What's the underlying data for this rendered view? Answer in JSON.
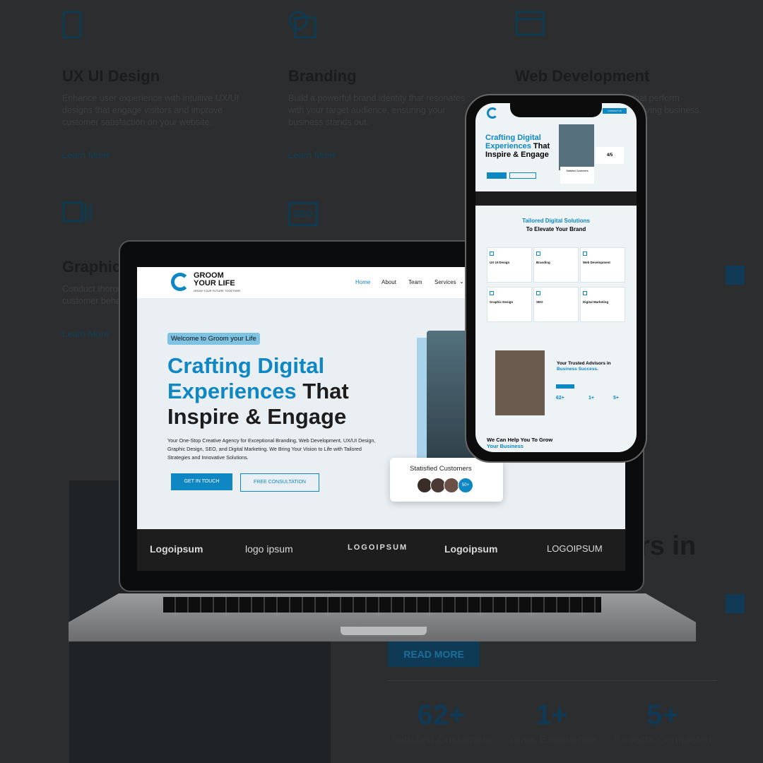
{
  "background": {
    "services": [
      {
        "title": "UX UI Design",
        "desc": "Enhance user experience with intuitive UX/UI designs that engage visitors and improve customer satisfaction on your website.",
        "link": "Learn More"
      },
      {
        "title": "Branding",
        "desc": "Build a powerful brand identity that resonates with your target audience, ensuring your business stands out.",
        "link": "Learn More"
      },
      {
        "title": "Web Development",
        "desc": "Develop responsive websites that perform seamlessly across all devices, driving business."
      },
      {
        "title": "Graphic Design",
        "desc": "Conduct thorough research to provide insights customer behavior.",
        "link": "Learn More"
      }
    ],
    "big_title_fragment": "rs in",
    "read_more": "READ MORE",
    "stats": [
      {
        "num": "62+",
        "label": "Satisfied Customers"
      },
      {
        "num": "1+",
        "label": "Years Experience"
      },
      {
        "num": "5+",
        "label": "Projects Completed"
      }
    ]
  },
  "laptop": {
    "brand_line1": "GROOM",
    "brand_line2": "YOUR LIFE",
    "brand_tagline": "GROW YOUR FUTURE TOGETHER",
    "nav": [
      "Home",
      "About",
      "Team",
      "Services"
    ],
    "badge": "Welcome to Groom your Life",
    "heading_blue": "Crafting Digital Experiences",
    "heading_dark": "That Inspire & Engage",
    "paragraph": "Your One-Stop Creative Agency for Exceptional Branding, Web Development, UX/UI Design, Graphic Design, SEO, and Digital Marketing. We Bring Your Vision to Life with Tailored Strategies and Innovative Solutions.",
    "btn_primary": "GET IN TOUCH",
    "btn_secondary": "FREE CONSULTATION",
    "satisfied_label": "Statisfied Customers",
    "satisfied_count": "50+",
    "logos": [
      "Logoipsum",
      "logo ipsum",
      "LOGOIPSUM",
      "Logoipsum",
      "LOGOIPSUM"
    ]
  },
  "phone": {
    "contact_btn": "CONTACT US",
    "heading_blue": "Crafting Digital Experiences",
    "heading_dark": "That Inspire & Engage",
    "rating": "4/5",
    "satisfied_label": "Satisfied Customers",
    "section_title_blue": "Tailored Digital Solutions",
    "section_title_dark": "To Elevate Your Brand",
    "cards": [
      "UX UI Design",
      "Branding",
      "Web Development",
      "Graphic Design",
      "SEO",
      "Digital Marketing"
    ],
    "advisors_dark": "Your Trusted Advisors in",
    "advisors_blue": "Business Success.",
    "stats": [
      {
        "num": "62+",
        "label": "Satisfied Customers"
      },
      {
        "num": "1+",
        "label": "Years Experience"
      },
      {
        "num": "5+",
        "label": "Projects Completed"
      }
    ],
    "help_dark": "We Can Help You To Grow",
    "help_blue": "Your Business"
  }
}
